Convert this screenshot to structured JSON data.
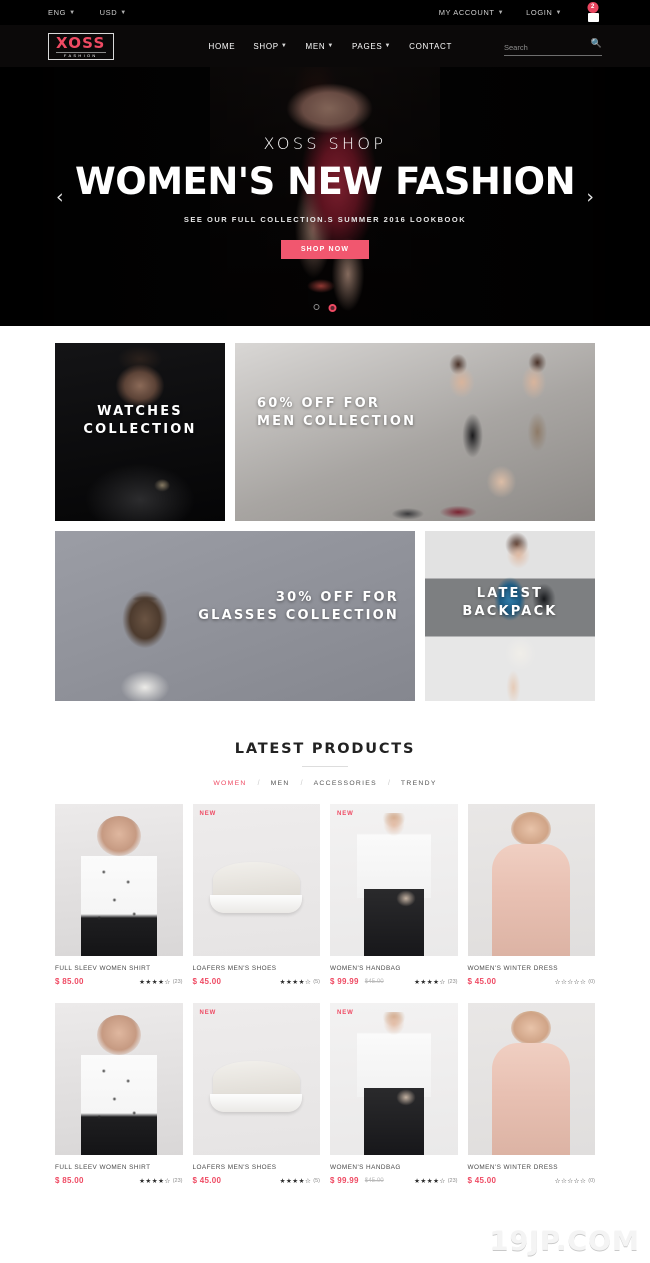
{
  "topbar": {
    "language": "ENG",
    "currency": "USD",
    "my_account": "MY ACCOUNT",
    "login": "LOGIN",
    "cart_count": "2"
  },
  "header": {
    "logo_main": "XOSS",
    "logo_sub": "FASHION",
    "nav": [
      {
        "label": "HOME",
        "has_caret": false
      },
      {
        "label": "SHOP",
        "has_caret": true
      },
      {
        "label": "MEN",
        "has_caret": true
      },
      {
        "label": "PAGES",
        "has_caret": true
      },
      {
        "label": "CONTACT",
        "has_caret": false
      }
    ],
    "search_placeholder": "Search"
  },
  "hero": {
    "kicker": "XOSS SHOP",
    "title": "WOMEN'S NEW FASHION",
    "subtitle": "SEE OUR FULL COLLECTION.S SUMMER 2016 LOOKBOOK",
    "button": "SHOP NOW",
    "prev": "‹",
    "next": "›",
    "slides": 2,
    "active_slide": 2
  },
  "promos": [
    {
      "line1": "WATCHES",
      "line2": "COLLECTION"
    },
    {
      "line1": "60% OFF FOR",
      "line2": "MEN COLLECTION"
    },
    {
      "line1": "30% OFF FOR",
      "line2": "GLASSES COLLECTION"
    },
    {
      "line1": "LATEST",
      "line2": "BACKPACK"
    }
  ],
  "products_section": {
    "title": "LATEST PRODUCTS",
    "filters": [
      {
        "label": "WOMEN",
        "active": true
      },
      {
        "label": "MEN",
        "active": false
      },
      {
        "label": "ACCESSORIES",
        "active": false
      },
      {
        "label": "TRENDY",
        "active": false
      }
    ],
    "separator": "/"
  },
  "products": [
    {
      "name": "FULL SLEEV WOMEN SHIRT",
      "price": "$ 85.00",
      "old_price": "",
      "badge": "",
      "stars_full": 4,
      "rating_count": "(23)"
    },
    {
      "name": "LOAFERS MEN'S SHOES",
      "price": "$ 45.00",
      "old_price": "",
      "badge": "NEW",
      "stars_full": 4,
      "rating_count": "(5)"
    },
    {
      "name": "WOMEN'S HANDBAG",
      "price": "$ 99.99",
      "old_price": "$45.00",
      "badge": "NEW",
      "stars_full": 4,
      "rating_count": "(23)"
    },
    {
      "name": "WOMEN'S WINTER DRESS",
      "price": "$ 45.00",
      "old_price": "",
      "badge": "",
      "stars_full": 0,
      "rating_count": "(0)"
    },
    {
      "name": "FULL SLEEV WOMEN SHIRT",
      "price": "$ 85.00",
      "old_price": "",
      "badge": "",
      "stars_full": 4,
      "rating_count": "(23)"
    },
    {
      "name": "LOAFERS MEN'S SHOES",
      "price": "$ 45.00",
      "old_price": "",
      "badge": "NEW",
      "stars_full": 4,
      "rating_count": "(5)"
    },
    {
      "name": "WOMEN'S HANDBAG",
      "price": "$ 99.99",
      "old_price": "$45.00",
      "badge": "NEW",
      "stars_full": 4,
      "rating_count": "(23)"
    },
    {
      "name": "WOMEN'S WINTER DRESS",
      "price": "$ 45.00",
      "old_price": "",
      "badge": "",
      "stars_full": 0,
      "rating_count": "(0)"
    }
  ],
  "watermark": "19JP.COM",
  "colors": {
    "accent": "#ef4a63",
    "button": "#f1576f",
    "dark": "#000000"
  }
}
